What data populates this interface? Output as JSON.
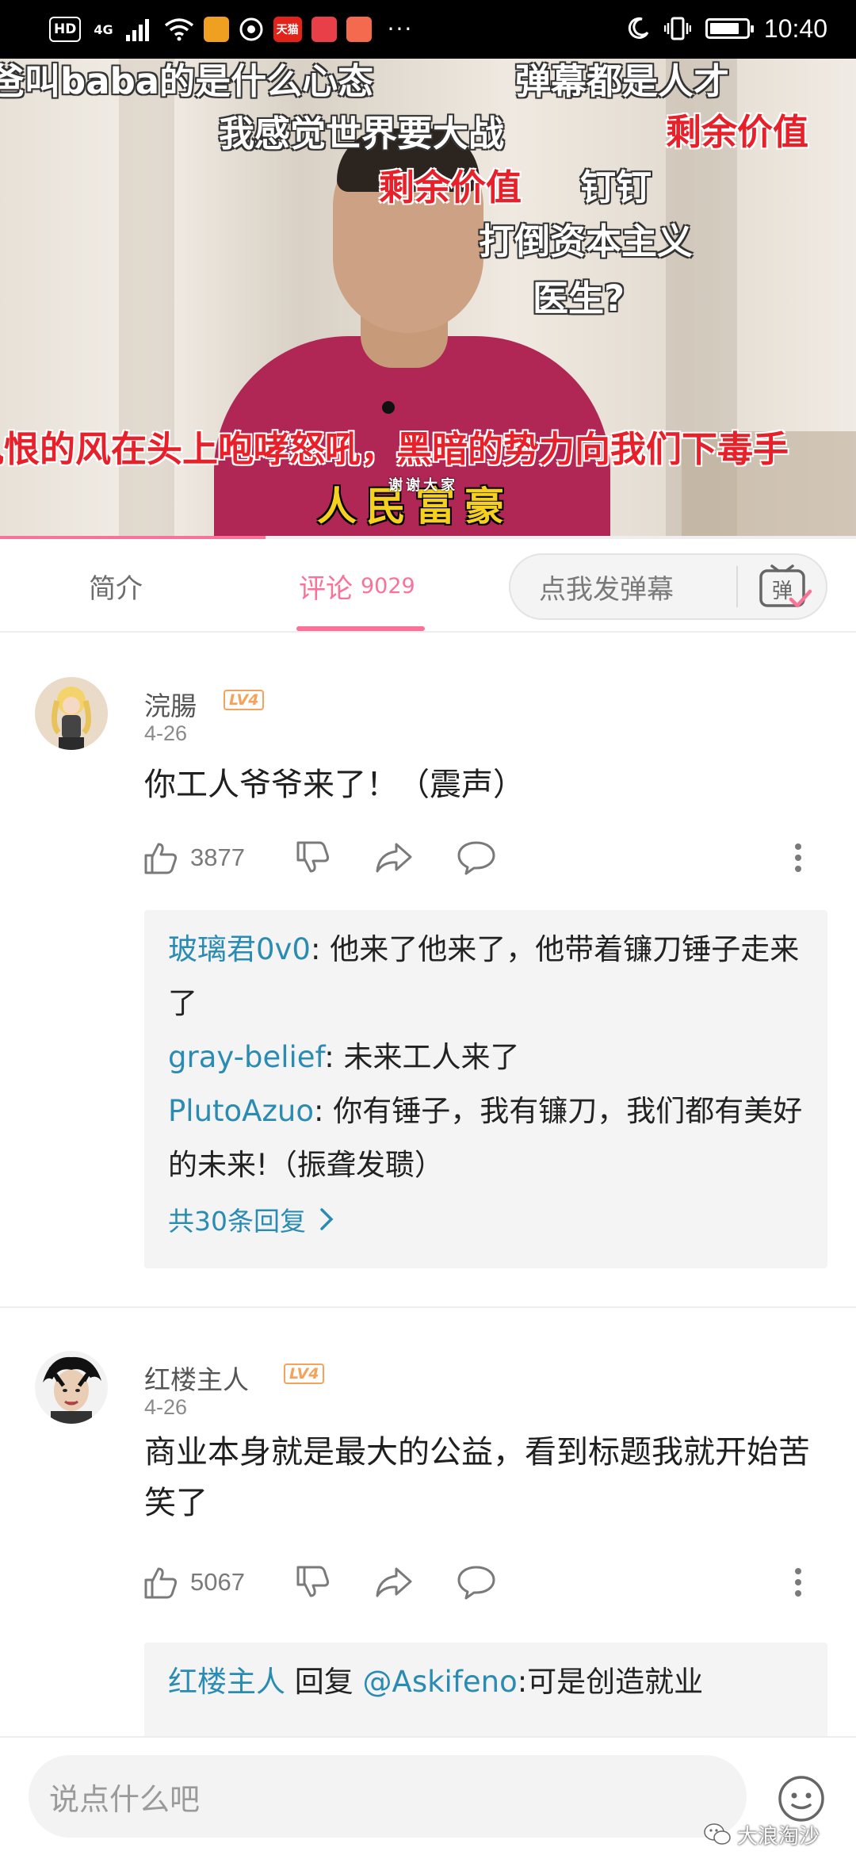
{
  "status_bar": {
    "hd": "HD",
    "network": "4G",
    "app_badge": "天猫",
    "overflow": "···",
    "time": "10:40",
    "battery_level": 0.85
  },
  "video": {
    "progress": 0.31,
    "danmaku": [
      {
        "text": "爸叫baba的是什么心态",
        "color": "white"
      },
      {
        "text": "弹幕都是人才",
        "color": "white"
      },
      {
        "text": "我感觉世界要大战",
        "color": "white"
      },
      {
        "text": "剩余价值",
        "color": "red"
      },
      {
        "text": "剩余价值",
        "color": "red"
      },
      {
        "text": "钉钉",
        "color": "white"
      },
      {
        "text": "打倒资本主义",
        "color": "white"
      },
      {
        "text": "医生?",
        "color": "white"
      },
      {
        "text": "仇恨的风在头上咆哮怒吼，黑暗的势力向我们下毒手",
        "color": "red"
      },
      {
        "text": "人民富豪",
        "color": "yellow"
      },
      {
        "text": "谢谢大家",
        "color": "white"
      }
    ]
  },
  "tabs": {
    "intro": "简介",
    "comments": "评论",
    "comments_count": "9029",
    "danmaku_placeholder": "点我发弹幕",
    "danmaku_icon_glyph": "弹"
  },
  "comments": [
    {
      "username": "浣腸",
      "level": "LV4",
      "date": "4-26",
      "content": "你工人爷爷来了！（震声）",
      "likes": "3877",
      "replies": [
        {
          "user": "玻璃君0v0",
          "text": "他来了他来了，他带着镰刀锤子走来了"
        },
        {
          "user": "gray-belief",
          "text": "未来工人来了"
        },
        {
          "user": "PlutoAzuo",
          "text": "你有锤子，我有镰刀，我们都有美好的未来!（振聋发聩）"
        }
      ],
      "more_replies": "共30条回复"
    },
    {
      "username": "红楼主人",
      "level": "LV4",
      "date": "4-26",
      "content": "商业本身就是最大的公益，看到标题我就开始苦笑了",
      "likes": "5067",
      "replies": [
        {
          "user": "红楼主人",
          "reply_word": "回复",
          "mention": "@Askifeno",
          "text": ":可是创造就业"
        }
      ]
    }
  ],
  "bottom_bar": {
    "placeholder": "说点什么吧",
    "watermark": "大浪淘沙"
  },
  "colors": {
    "accent": "#fb7299",
    "link": "#2a8bb3",
    "level_badge": "#f3a35b"
  }
}
